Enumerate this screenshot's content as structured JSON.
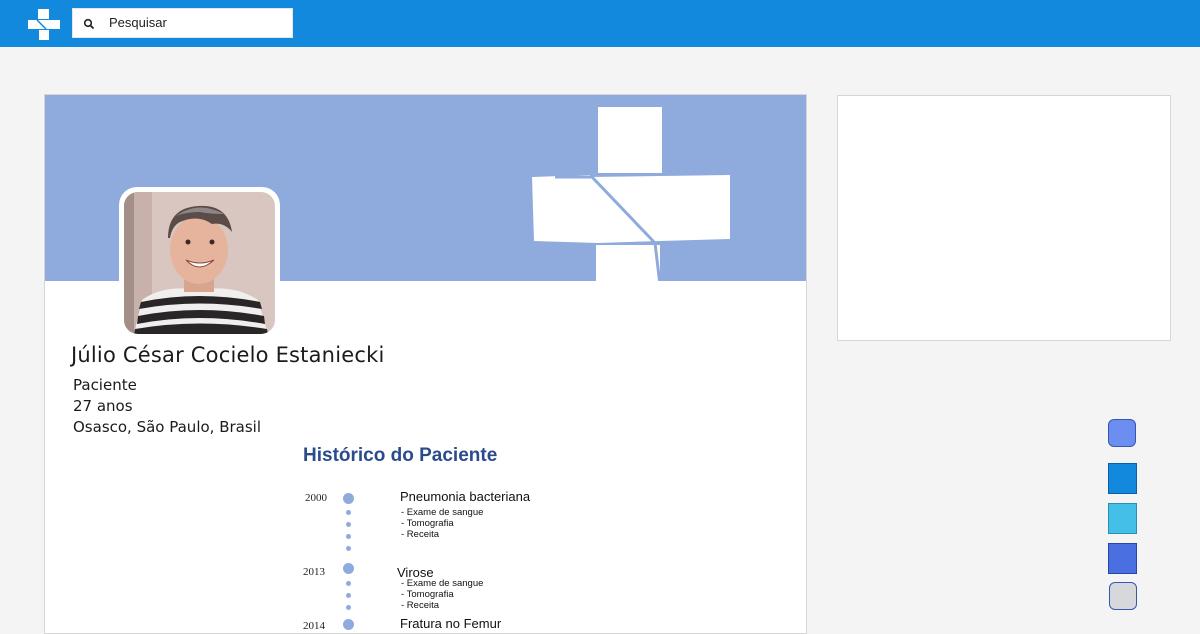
{
  "header": {
    "search_placeholder": "Pesquisar",
    "logo_icon": "medical-cross-icon",
    "search_icon": "search-icon"
  },
  "profile": {
    "name": "Júlio César Cocielo Estaniecki",
    "role": "Paciente",
    "age": "27 anos",
    "location": "Osasco, São Paulo, Brasil"
  },
  "history": {
    "title": "Histórico do Paciente",
    "events": [
      {
        "year": "2000",
        "title": "Pneumonia bacteriana",
        "items": [
          "- Exame de sangue",
          "- Tomografia",
          "- Receita"
        ]
      },
      {
        "year": "2013",
        "title": "Virose",
        "items": [
          "- Exame de sangue",
          "- Tomografia",
          "- Receita"
        ]
      },
      {
        "year": "2014",
        "title": "Fratura no Femur",
        "items": []
      }
    ]
  },
  "swatches": [
    {
      "name": "swatch-periwinkle",
      "color": "#6b8ef0"
    },
    {
      "name": "swatch-blue",
      "color": "#1389de"
    },
    {
      "name": "swatch-sky",
      "color": "#44c0e8"
    },
    {
      "name": "swatch-royal",
      "color": "#4a6fe0"
    },
    {
      "name": "swatch-gray",
      "color": "#d6d8dc"
    }
  ],
  "colors": {
    "topbar": "#1389de",
    "cover": "#8faadd",
    "history_title": "#2a4c8c",
    "background": "#f4f4f4"
  }
}
